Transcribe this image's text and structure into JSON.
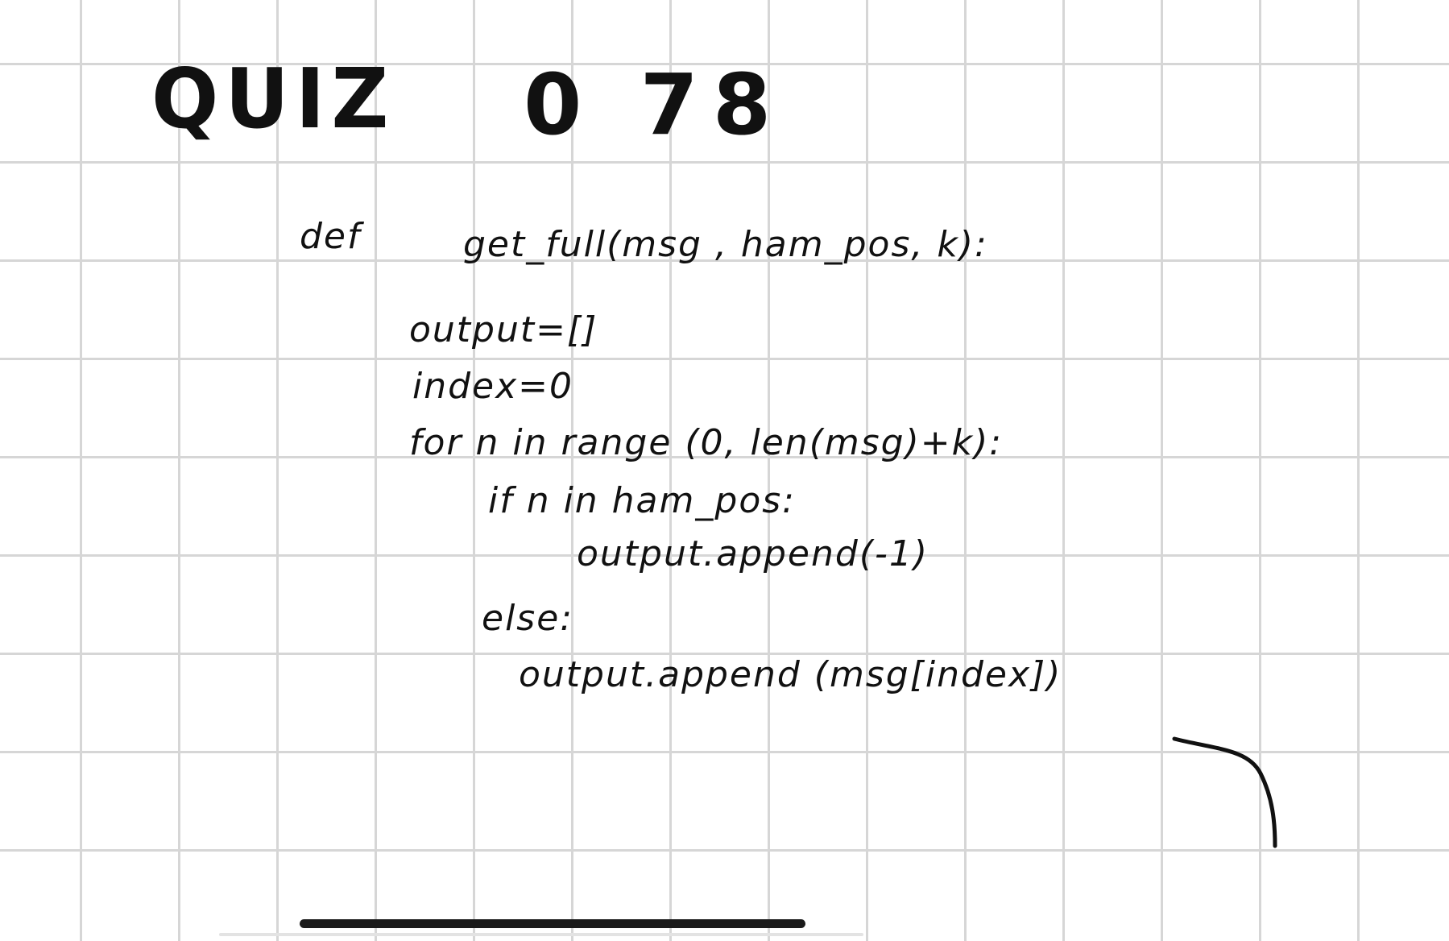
{
  "page": {
    "grid_color": "#d6d6d6",
    "ink_color": "#111111",
    "background": "#ffffff"
  },
  "heading": {
    "quiz": "QUIZ",
    "number": "0 78"
  },
  "code": {
    "def_keyword": "def",
    "signature": "get_full(msg , ham_pos, k):",
    "lines": [
      "output=[]",
      "index=0",
      "for n in range (0, len(msg)+k):",
      "if n in ham_pos:",
      "output.append(-1)",
      "else:",
      "output.append (msg[index])"
    ]
  },
  "icons": {
    "home_indicator": "home-indicator-bar",
    "pen_stroke": "curved-pen-stroke"
  }
}
